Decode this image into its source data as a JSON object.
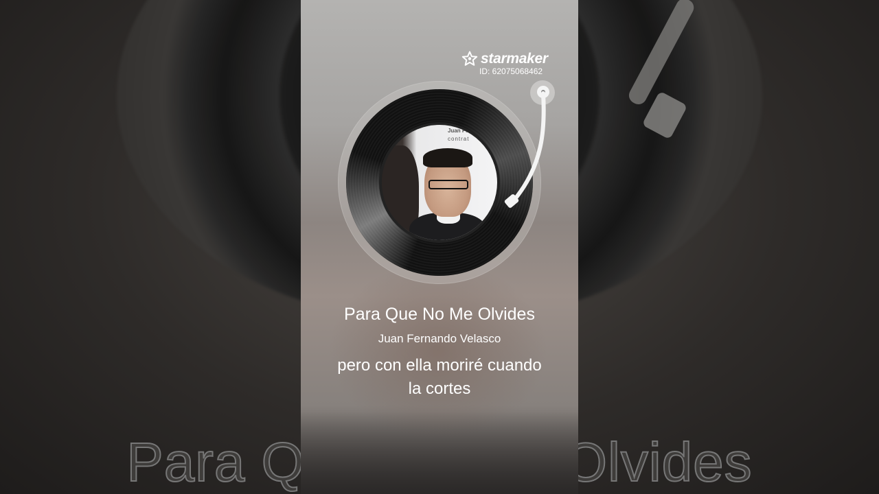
{
  "brand": {
    "name": "starmaker",
    "id_label": "ID: 62075068462"
  },
  "album_cover": {
    "text_top": "Juan Ferna",
    "text_sub": "contrat"
  },
  "song": {
    "title": "Para Que No Me Olvides",
    "artist": "Juan Fernando Velasco"
  },
  "lyrics": {
    "line1": "pero con ella moriré cuando",
    "line2": "la cortes"
  },
  "background": {
    "title_echo": "Para Que No Me Olvides"
  },
  "colors": {
    "text": "#ffffff",
    "vinyl": "#111111"
  }
}
